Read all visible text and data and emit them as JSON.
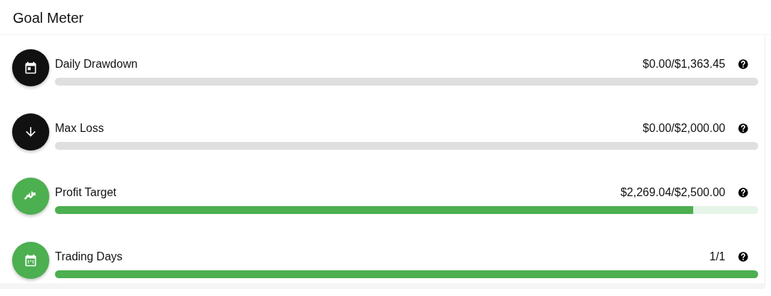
{
  "title": "Goal Meter",
  "meters": [
    {
      "kind": "calendar",
      "label": "Daily Drawdown",
      "reading": "$0.00/$1,363.45",
      "level": 0,
      "color": "#111111"
    },
    {
      "kind": "arrow-down",
      "label": "Max Loss",
      "reading": "$0.00/$2,000.00",
      "level": 0,
      "color": "#111111"
    },
    {
      "kind": "chart",
      "label": "Profit Target",
      "reading": "$2,269.04/$2,500.00",
      "level": 0.9076,
      "color": "#4caf50"
    },
    {
      "kind": "calendar-days",
      "label": "Trading Days",
      "reading": "1/1",
      "level": 1,
      "color": "#4caf50"
    }
  ]
}
